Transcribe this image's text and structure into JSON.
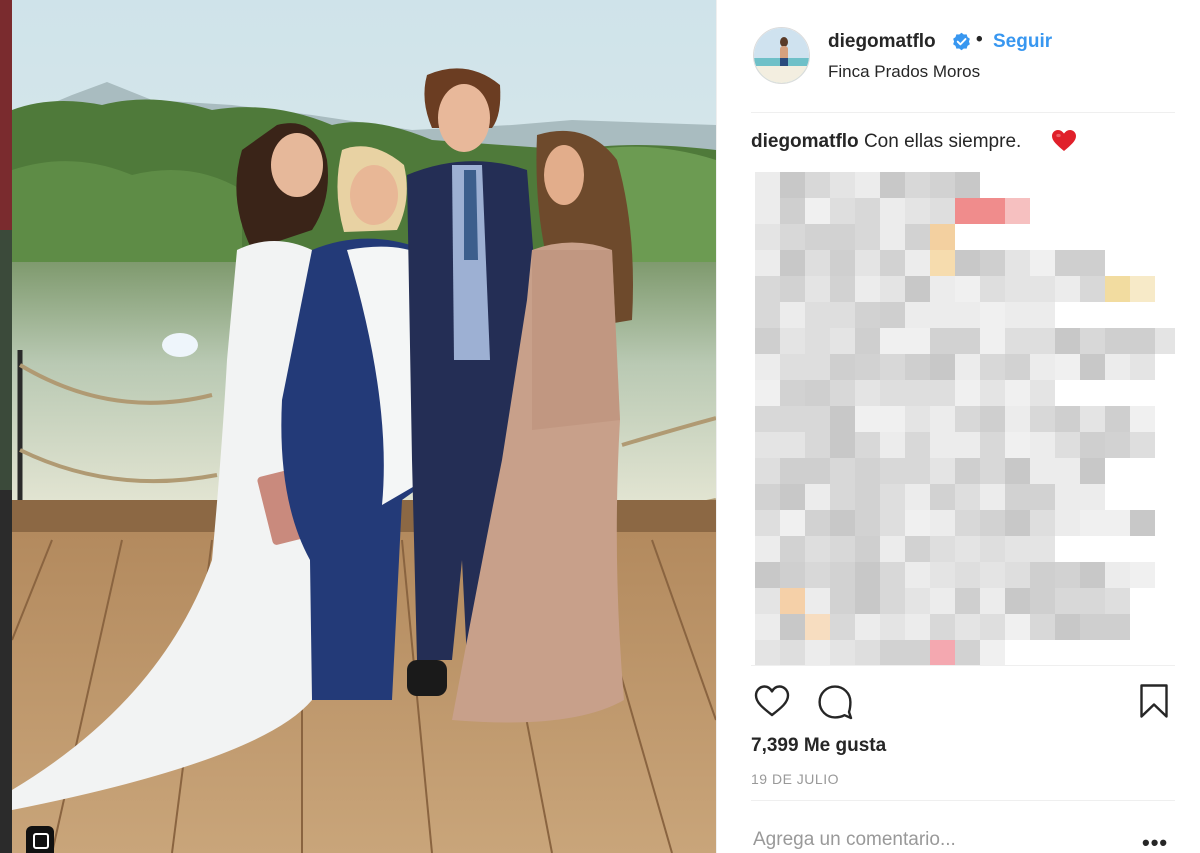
{
  "post": {
    "username": "diegomatflo",
    "follow_label": "Seguir",
    "separator": "•",
    "location": "Finca Prados Moros",
    "caption_user": "diegomatflo",
    "caption_text": "Con ellas siempre.",
    "caption_emoji": "red-heart-icon",
    "likes": "7,399 Me gusta",
    "date": "19 DE JULIO",
    "comment_placeholder": "Agrega un comentario...",
    "more_label": "•••"
  },
  "icons": {
    "verified": "verified-badge-icon",
    "like": "heart-outline-icon",
    "comment": "speech-bubble-icon",
    "save": "bookmark-icon",
    "more": "ellipsis-icon"
  },
  "colors": {
    "link": "#3897f0",
    "verified_badge": "#3897f0",
    "heart_emoji": "#e0202a",
    "text": "#262626",
    "muted": "#999999",
    "divider": "#efefef"
  }
}
